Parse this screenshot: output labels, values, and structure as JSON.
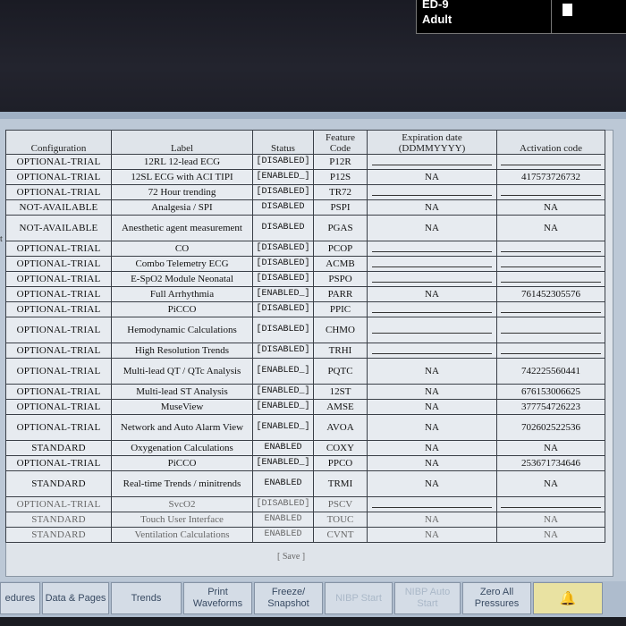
{
  "patient": {
    "bed": "ED-9",
    "type": "Adult"
  },
  "edge_text": "t",
  "table": {
    "headers": [
      "Configuration",
      "Label",
      "Status",
      "Feature Code",
      "Expiration date (DDMMYYYY)",
      "Activation code"
    ],
    "rows": [
      {
        "config": "OPTIONAL-TRIAL",
        "label": "12RL 12-lead ECG",
        "status": "[DISABLED]",
        "code": "P12R",
        "expiration": "",
        "activation": ""
      },
      {
        "config": "OPTIONAL-TRIAL",
        "label": "12SL ECG with ACI TIPI",
        "status": "[ENABLED_]",
        "code": "P12S",
        "expiration": "NA",
        "activation": "417573726732"
      },
      {
        "config": "OPTIONAL-TRIAL",
        "label": "72 Hour trending",
        "status": "[DISABLED]",
        "code": "TR72",
        "expiration": "",
        "activation": ""
      },
      {
        "config": "NOT-AVAILABLE",
        "label": "Analgesia / SPI",
        "status": "DISABLED",
        "code": "PSPI",
        "expiration": "NA",
        "activation": "NA"
      },
      {
        "config": "NOT-AVAILABLE",
        "label": "Anesthetic agent measurement",
        "status": "DISABLED",
        "code": "PGAS",
        "expiration": "NA",
        "activation": "NA",
        "tall": true
      },
      {
        "config": "OPTIONAL-TRIAL",
        "label": "CO",
        "status": "[DISABLED]",
        "code": "PCOP",
        "expiration": "",
        "activation": ""
      },
      {
        "config": "OPTIONAL-TRIAL",
        "label": "Combo Telemetry ECG",
        "status": "[DISABLED]",
        "code": "ACMB",
        "expiration": "",
        "activation": ""
      },
      {
        "config": "OPTIONAL-TRIAL",
        "label": "E-SpO2 Module Neonatal",
        "status": "[DISABLED]",
        "code": "PSPO",
        "expiration": "",
        "activation": ""
      },
      {
        "config": "OPTIONAL-TRIAL",
        "label": "Full Arrhythmia",
        "status": "[ENABLED_]",
        "code": "PARR",
        "expiration": "NA",
        "activation": "761452305576"
      },
      {
        "config": "OPTIONAL-TRIAL",
        "label": "PiCCO",
        "status": "[DISABLED]",
        "code": "PPIC",
        "expiration": "",
        "activation": ""
      },
      {
        "config": "OPTIONAL-TRIAL",
        "label": "Hemodynamic Calculations",
        "status": "[DISABLED]",
        "code": "CHMO",
        "expiration": "",
        "activation": "",
        "tall": true
      },
      {
        "config": "OPTIONAL-TRIAL",
        "label": "High Resolution Trends",
        "status": "[DISABLED]",
        "code": "TRHI",
        "expiration": "",
        "activation": ""
      },
      {
        "config": "OPTIONAL-TRIAL",
        "label": "Multi-lead QT / QTc Analysis",
        "status": "[ENABLED_]",
        "code": "PQTC",
        "expiration": "NA",
        "activation": "742225560441",
        "tall": true
      },
      {
        "config": "OPTIONAL-TRIAL",
        "label": "Multi-lead ST Analysis",
        "status": "[ENABLED_]",
        "code": "12ST",
        "expiration": "NA",
        "activation": "676153006625"
      },
      {
        "config": "OPTIONAL-TRIAL",
        "label": "MuseView",
        "status": "[ENABLED_]",
        "code": "AMSE",
        "expiration": "NA",
        "activation": "377754726223"
      },
      {
        "config": "OPTIONAL-TRIAL",
        "label": "Network and Auto Alarm View",
        "status": "[ENABLED_]",
        "code": "AVOA",
        "expiration": "NA",
        "activation": "702602522536",
        "tall": true
      },
      {
        "config": "STANDARD",
        "label": "Oxygenation Calculations",
        "status": "ENABLED",
        "code": "COXY",
        "expiration": "NA",
        "activation": "NA"
      },
      {
        "config": "OPTIONAL-TRIAL",
        "label": "PiCCO",
        "status": "[ENABLED_]",
        "code": "PPCO",
        "expiration": "NA",
        "activation": "253671734646"
      },
      {
        "config": "STANDARD",
        "label": "Real-time Trends / minitrends",
        "status": "ENABLED",
        "code": "TRMI",
        "expiration": "NA",
        "activation": "NA",
        "tall": true
      },
      {
        "config": "OPTIONAL-TRIAL",
        "label": "SvcO2",
        "status": "[DISABLED]",
        "code": "PSCV",
        "expiration": "",
        "activation": "",
        "faded": true
      },
      {
        "config": "STANDARD",
        "label": "Touch User Interface",
        "status": "ENABLED",
        "code": "TOUC",
        "expiration": "NA",
        "activation": "NA",
        "faded": true
      },
      {
        "config": "STANDARD",
        "label": "Ventilation Calculations",
        "status": "ENABLED",
        "code": "CVNT",
        "expiration": "NA",
        "activation": "NA",
        "faded": true
      }
    ]
  },
  "save_label": "[ Save ]",
  "buttons": [
    {
      "label": "edures",
      "name": "procedures-button",
      "enabled": true
    },
    {
      "label": "Data & Pages",
      "name": "data-pages-button",
      "enabled": true
    },
    {
      "label": "Trends",
      "name": "trends-button",
      "enabled": true
    },
    {
      "label": "Print Waveforms",
      "name": "print-waveforms-button",
      "enabled": true
    },
    {
      "label": "Freeze/ Snapshot",
      "name": "freeze-snapshot-button",
      "enabled": true
    },
    {
      "label": "NIBP Start",
      "name": "nibp-start-button",
      "enabled": false
    },
    {
      "label": "NIBP Auto Start",
      "name": "nibp-auto-button",
      "enabled": false
    },
    {
      "label": "Zero All Pressures",
      "name": "zero-all-pressures-button",
      "enabled": true
    },
    {
      "label": "🔔",
      "name": "alarm-silence-button",
      "enabled": true,
      "icon": "bell-icon"
    }
  ]
}
